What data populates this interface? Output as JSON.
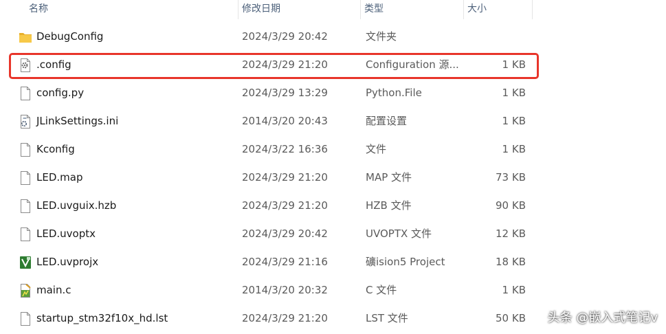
{
  "header": {
    "name": "名称",
    "date": "修改日期",
    "type": "类型",
    "size": "大小"
  },
  "files": [
    {
      "icon": "folder-icon",
      "name": "DebugConfig",
      "date": "2024/3/29 20:42",
      "type": "文件夹",
      "size": ""
    },
    {
      "icon": "config-file-icon",
      "name": ".config",
      "date": "2024/3/29 21:20",
      "type": "Configuration 源...",
      "size": "1 KB"
    },
    {
      "icon": "file-icon",
      "name": "config.py",
      "date": "2024/3/29 13:29",
      "type": "Python.File",
      "size": "1 KB"
    },
    {
      "icon": "settings-file-icon",
      "name": "JLinkSettings.ini",
      "date": "2014/3/20 20:43",
      "type": "配置设置",
      "size": "1 KB"
    },
    {
      "icon": "file-icon",
      "name": "Kconfig",
      "date": "2024/3/22 16:36",
      "type": "文件",
      "size": "1 KB"
    },
    {
      "icon": "file-icon",
      "name": "LED.map",
      "date": "2024/3/29 21:20",
      "type": "MAP 文件",
      "size": "73 KB"
    },
    {
      "icon": "file-icon",
      "name": "LED.uvguix.hzb",
      "date": "2024/3/29 21:20",
      "type": "HZB 文件",
      "size": "90 KB"
    },
    {
      "icon": "file-icon",
      "name": "LED.uvoptx",
      "date": "2024/3/29 20:42",
      "type": "UVOPTX 文件",
      "size": "12 KB"
    },
    {
      "icon": "keil-project-icon",
      "name": "LED.uvprojx",
      "date": "2024/3/29 21:16",
      "type": "礦ision5 Project",
      "size": "18 KB"
    },
    {
      "icon": "c-source-icon",
      "name": "main.c",
      "date": "2014/3/20 20:32",
      "type": "C 文件",
      "size": "1 KB"
    },
    {
      "icon": "file-icon",
      "name": "startup_stm32f10x_hd.lst",
      "date": "2024/3/29 21:20",
      "type": "LST 文件",
      "size": "50 KB"
    }
  ],
  "watermark": "头条 @嵌入式笔记v",
  "colors": {
    "highlight": "#e8352a",
    "header_text": "#4c607a",
    "folder": "#f5c342"
  }
}
